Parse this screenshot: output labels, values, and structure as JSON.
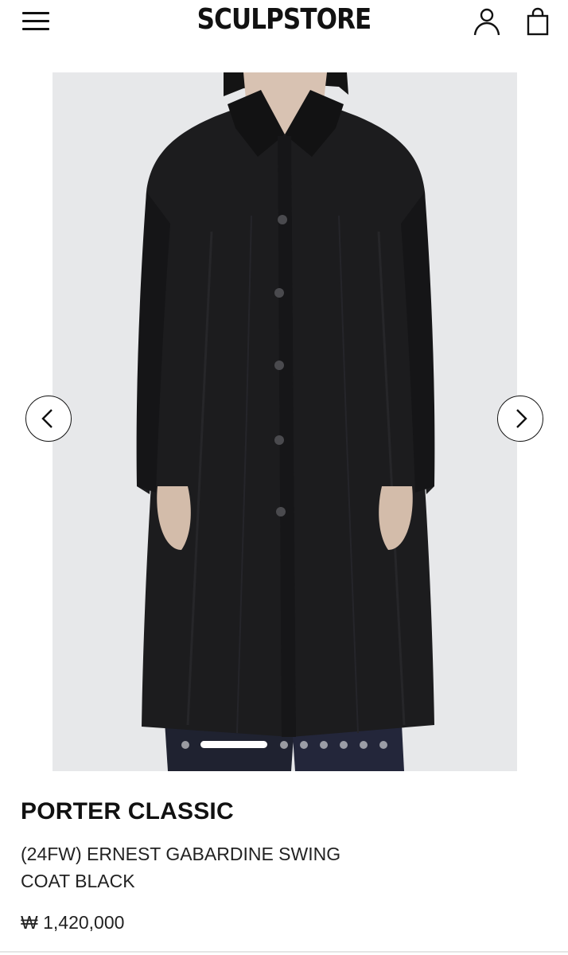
{
  "header": {
    "logo": "SCULPSTORE",
    "menu_icon": "hamburger-menu-icon",
    "account_icon": "user-icon",
    "cart_icon": "shopping-bag-icon"
  },
  "gallery": {
    "image_alt": "Model wearing black gabardine swing coat",
    "prev_icon": "chevron-left-icon",
    "next_icon": "chevron-right-icon",
    "slide_count": 8,
    "active_slide": 2,
    "background_color": "#e7e8ea",
    "coat_color": "#1c1c1e"
  },
  "product": {
    "brand": "PORTER CLASSIC",
    "name": "(24FW) ERNEST GABARDINE SWING COAT BLACK",
    "price": "₩ 1,420,000"
  }
}
